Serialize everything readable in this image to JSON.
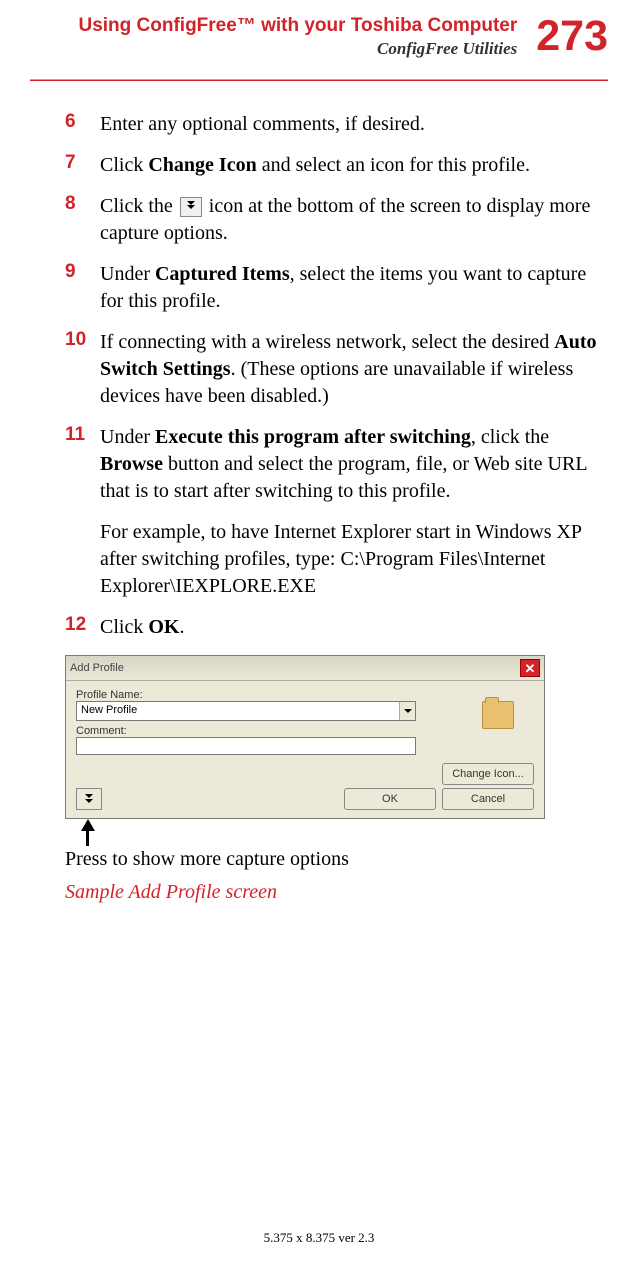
{
  "header": {
    "title": "Using ConfigFree™ with your Toshiba Computer",
    "subtitle": "ConfigFree Utilities",
    "page_number": "273"
  },
  "steps": [
    {
      "num": "6",
      "parts": [
        {
          "t": "Enter any optional comments, if desired."
        }
      ]
    },
    {
      "num": "7",
      "parts": [
        {
          "t": "Click "
        },
        {
          "t": "Change Icon",
          "b": true
        },
        {
          "t": " and select an icon for this profile."
        }
      ]
    },
    {
      "num": "8",
      "parts": [
        {
          "t": "Click the "
        },
        {
          "icon": true
        },
        {
          "t": " icon at the bottom of the screen to display more capture options."
        }
      ]
    },
    {
      "num": "9",
      "parts": [
        {
          "t": "Under "
        },
        {
          "t": "Captured Items",
          "b": true
        },
        {
          "t": ", select the items you want to capture for this profile."
        }
      ]
    },
    {
      "num": "10",
      "parts": [
        {
          "t": "If connecting with a wireless network, select the desired "
        },
        {
          "t": "Auto Switch Settings",
          "b": true
        },
        {
          "t": ". (These options are unavailable if wireless devices have been disabled.)"
        }
      ]
    },
    {
      "num": "11",
      "parts": [
        {
          "t": "Under "
        },
        {
          "t": "Execute this program after switching",
          "b": true
        },
        {
          "t": ", click the "
        },
        {
          "t": "Browse",
          "b": true
        },
        {
          "t": " button and select the program, file, or Web site URL that is to start after switching to this profile."
        }
      ]
    }
  ],
  "sub_paragraph": "For example, to have Internet Explorer start in Windows XP after switching profiles, type: C:\\Program Files\\Internet Explorer\\IEXPLORE.EXE",
  "step12": {
    "num": "12",
    "parts": [
      {
        "t": " Click "
      },
      {
        "t": "OK",
        "b": true
      },
      {
        "t": "."
      }
    ]
  },
  "dialog": {
    "title": "Add Profile",
    "profile_name_label": "Profile Name:",
    "profile_name_value": "New Profile",
    "comment_label": "Comment:",
    "comment_value": "",
    "change_icon_btn": "Change Icon...",
    "ok_btn": "OK",
    "cancel_btn": "Cancel"
  },
  "annotation": "Press to show more capture options",
  "caption": "Sample Add Profile screen",
  "footer": "5.375 x 8.375 ver 2.3"
}
